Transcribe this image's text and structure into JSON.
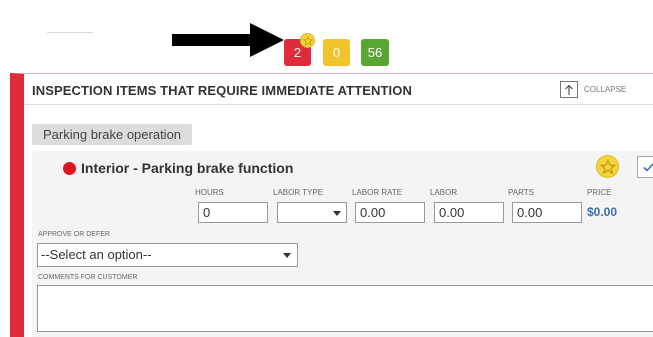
{
  "summary_badges": [
    {
      "value": "2",
      "color": "#e02b3a"
    },
    {
      "value": "0",
      "color": "#f0c22c"
    },
    {
      "value": "56",
      "color": "#5aa632"
    }
  ],
  "section": {
    "title": "INSPECTION ITEMS THAT REQUIRE IMMEDIATE ATTENTION",
    "collapse_label": "COLLAPSE",
    "accent_color": "#e02b3a"
  },
  "group": {
    "label": "Parking brake operation"
  },
  "item": {
    "status_color": "#e0141e",
    "title": "Interior - Parking brake function",
    "columns": {
      "hours": "HOURS",
      "labor_type": "LABOR TYPE",
      "labor_rate": "LABOR RATE",
      "labor": "LABOR",
      "parts": "PARTS",
      "price": "PRICE"
    },
    "values": {
      "hours": "0",
      "labor_type": "",
      "labor_rate": "0.00",
      "labor": "0.00",
      "parts": "0.00",
      "price": "$0.00"
    },
    "approve_label": "APPROVE OR DEFER",
    "approve_value": "--Select an option--",
    "comments_label": "COMMENTS FOR CUSTOMER",
    "comments_value": ""
  },
  "icons": {
    "favorite": "star-icon",
    "check": "checkmark-icon",
    "collapse": "arrow-up-icon",
    "annotation": "arrow-right-icon"
  }
}
